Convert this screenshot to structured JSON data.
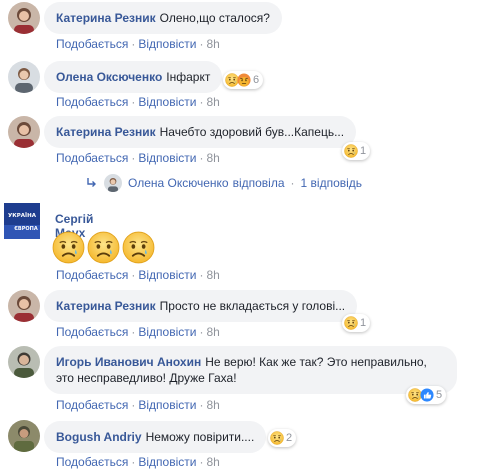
{
  "labels": {
    "like": "Подобається",
    "reply": "Відповісти",
    "dot": "·"
  },
  "colors": {
    "name": "#385898",
    "link": "#4267b2",
    "meta": "#90949c",
    "bubble": "#f2f3f5",
    "emoji_face": "#f7b125"
  },
  "comments": [
    {
      "name": "Катерина Резник",
      "text": "Олено,що сталося?",
      "time": "8h"
    },
    {
      "name": "Олена Оксюченко",
      "text": "Інфаркт",
      "time": "8h",
      "reaction_icons": [
        "sad-icon",
        "angry-icon"
      ],
      "reaction_count": "6"
    },
    {
      "name": "Катерина Резник",
      "text": "Начебто здоровий був...Капець...",
      "time": "8h",
      "reaction_icons": [
        "sad-icon"
      ],
      "reaction_count": "1"
    },
    {
      "name": "Сергій Маух",
      "text": "",
      "time": "8h",
      "avatar_text": "УКРАЇНА ЄВРОПА"
    },
    {
      "name": "Катерина Резник",
      "text": "Просто не вкладається у голові...",
      "time": "8h",
      "reaction_icons": [
        "sad-icon"
      ],
      "reaction_count": "1"
    },
    {
      "name": "Игорь Иванович Анохин",
      "text": "Не верю! Как же так? Это неправильно, это несправедливо! Друже Гаха!",
      "time": "8h",
      "reaction_icons": [
        "sad-icon",
        "like-icon"
      ],
      "reaction_count": "5"
    },
    {
      "name": "Bogush Andriy",
      "text": "Неможу повірити....",
      "time": "8h",
      "reaction_icons": [
        "sad-icon"
      ],
      "reaction_count": "2"
    }
  ],
  "reply_summary": {
    "author": "Олена Оксюченко",
    "action": "відповіла",
    "dot": "·",
    "count_text": "1 відповідь"
  },
  "big_emojis": [
    "sad-emoji",
    "sad-emoji",
    "sad-emoji"
  ]
}
